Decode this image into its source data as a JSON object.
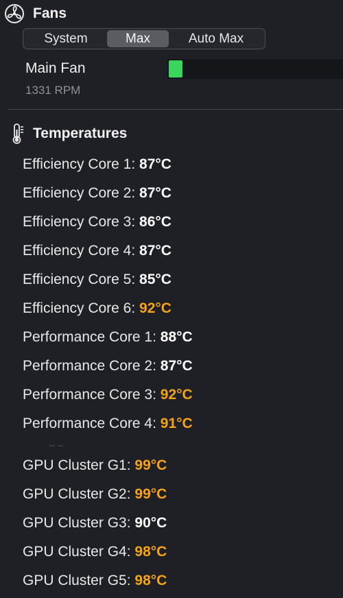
{
  "fans": {
    "title": "Fans",
    "icon": "fan-icon",
    "modes": [
      "System",
      "Max",
      "Auto Max"
    ],
    "active_mode": "Max",
    "main_fan": {
      "name": "Main Fan",
      "rpm": "1331 RPM",
      "level": 0.08,
      "bar_color": "#3bd45d"
    }
  },
  "temperatures": {
    "title": "Temperatures",
    "icon": "thermometer-icon",
    "hot_color": "#f5a318",
    "normal_color": "#ffffff",
    "sensors": [
      {
        "label": "Efficiency Core 1: ",
        "value": "87°C",
        "hot": false
      },
      {
        "label": "Efficiency Core 2: ",
        "value": "87°C",
        "hot": false
      },
      {
        "label": "Efficiency Core 3: ",
        "value": "86°C",
        "hot": false
      },
      {
        "label": "Efficiency Core 4: ",
        "value": "87°C",
        "hot": false
      },
      {
        "label": "Efficiency Core 5: ",
        "value": "85°C",
        "hot": false
      },
      {
        "label": "Efficiency Core 6: ",
        "value": "92°C",
        "hot": true
      },
      {
        "label": "Performance Core 1: ",
        "value": "88°C",
        "hot": false
      },
      {
        "label": "Performance Core 2: ",
        "value": "87°C",
        "hot": false
      },
      {
        "label": "Performance Core 3: ",
        "value": "92°C",
        "hot": true
      },
      {
        "label": "Performance Core 4: ",
        "value": "91°C",
        "hot": true
      },
      {
        "label": "GPU Cluster G1: ",
        "value": "99°C",
        "hot": true
      },
      {
        "label": "GPU Cluster G2: ",
        "value": "99°C",
        "hot": true
      },
      {
        "label": "GPU Cluster G3: ",
        "value": "90°C",
        "hot": false
      },
      {
        "label": "GPU Cluster G4: ",
        "value": "98°C",
        "hot": true
      },
      {
        "label": "GPU Cluster G5: ",
        "value": "98°C",
        "hot": true
      }
    ]
  }
}
